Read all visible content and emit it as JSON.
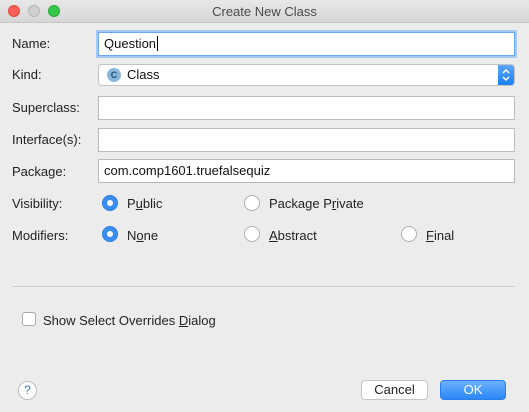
{
  "window": {
    "title": "Create New Class"
  },
  "form": {
    "name_label": "Name:",
    "name_value": "Question",
    "kind_label": "Kind:",
    "kind_value": "Class",
    "kind_icon_letter": "C",
    "superclass_label": "Superclass:",
    "superclass_value": "",
    "interfaces_label": "Interface(s):",
    "interfaces_value": "",
    "package_label": "Package:",
    "package_value": "com.comp1601.truefalsequiz"
  },
  "visibility": {
    "label": "Visibility:",
    "options": [
      {
        "pre": "P",
        "mn": "u",
        "post": "blic"
      },
      {
        "pre": "Package P",
        "mn": "r",
        "post": "ivate"
      }
    ],
    "selected": "Public"
  },
  "modifiers": {
    "label": "Modifiers:",
    "options": [
      {
        "pre": "N",
        "mn": "o",
        "post": "ne"
      },
      {
        "pre": "",
        "mn": "A",
        "post": "bstract"
      },
      {
        "pre": "",
        "mn": "F",
        "post": "inal"
      }
    ],
    "selected": "None"
  },
  "overrides": {
    "pre": "Show Select Overrides ",
    "mn": "D",
    "post": "ialog",
    "checked": false
  },
  "footer": {
    "help_label": "?",
    "cancel_label": "Cancel",
    "ok_label": "OK"
  },
  "colors": {
    "accent": "#3b8ef1",
    "close": "#fc5f57",
    "maximize": "#35c94a"
  }
}
